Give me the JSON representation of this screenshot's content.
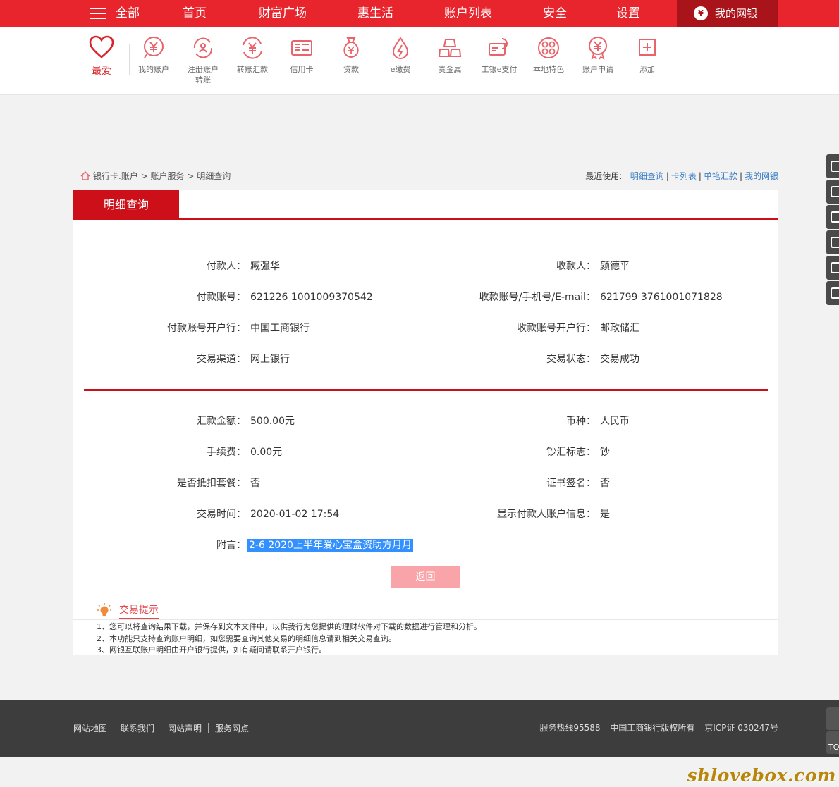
{
  "topnav": {
    "all": "全部",
    "items": [
      "首页",
      "财富广场",
      "惠生活",
      "账户列表",
      "安全",
      "设置"
    ],
    "mybank": "我的网银",
    "mybank_icon": "¥"
  },
  "shortcuts": {
    "fav": "最爱",
    "items": [
      {
        "label": "我的账户",
        "icon": "yen-circle-icon"
      },
      {
        "label": "注册账户转账",
        "icon": "person-transfer-icon"
      },
      {
        "label": "转账汇款",
        "icon": "yen-arrows-icon"
      },
      {
        "label": "信用卡",
        "icon": "card-icon"
      },
      {
        "label": "贷款",
        "icon": "money-bag-icon"
      },
      {
        "label": "e缴费",
        "icon": "drop-bolt-icon"
      },
      {
        "label": "贵金属",
        "icon": "gold-bars-icon"
      },
      {
        "label": "工银e支付",
        "icon": "epay-icon"
      },
      {
        "label": "本地特色",
        "icon": "dots-circle-icon"
      },
      {
        "label": "账户申请",
        "icon": "yen-ribbon-icon"
      },
      {
        "label": "添加",
        "icon": "plus-square-icon"
      }
    ]
  },
  "breadcrumb": {
    "items": [
      "银行卡.账户",
      "账户服务",
      "明细查询"
    ],
    "sep": ">"
  },
  "recent": {
    "label": "最近使用:",
    "links": [
      "明细查询",
      "卡列表",
      "单笔汇款",
      "我的网银"
    ]
  },
  "panel": {
    "tab": "明细查询",
    "fields_top_left": [
      {
        "k": "付款人：",
        "v": "臧强华"
      },
      {
        "k": "付款账号：",
        "v": "621226 1001009370542"
      },
      {
        "k": "付款账号开户行：",
        "v": "中国工商银行"
      },
      {
        "k": "交易渠道：",
        "v": "网上银行"
      }
    ],
    "fields_top_right": [
      {
        "k": "收款人：",
        "v": "颜德平"
      },
      {
        "k": "收款账号/手机号/E-mail：",
        "v": "621799 3761001071828"
      },
      {
        "k": "收款账号开户行：",
        "v": "邮政储汇"
      },
      {
        "k": "交易状态：",
        "v": "交易成功"
      }
    ],
    "fields_bottom_left": [
      {
        "k": "汇款金额：",
        "v": "500.00元"
      },
      {
        "k": "手续费：",
        "v": "0.00元"
      },
      {
        "k": "是否抵扣套餐：",
        "v": "否"
      },
      {
        "k": "交易时间：",
        "v": "2020-01-02 17:54"
      }
    ],
    "fields_bottom_right": [
      {
        "k": "币种：",
        "v": "人民币"
      },
      {
        "k": "钞汇标志：",
        "v": "钞"
      },
      {
        "k": "证书签名：",
        "v": "否"
      },
      {
        "k": "显示付款人账户信息：",
        "v": "是"
      }
    ],
    "remark": {
      "k": "附言：",
      "v": "2-6 2020上半年爱心宝盒资助方月月"
    },
    "back": "返回"
  },
  "tips": {
    "title": "交易提示",
    "lines": [
      "1、您可以将查询结果下载，并保存到文本文件中，以供我行为您提供的理财软件对下载的数据进行管理和分析。",
      "2、本功能只支持查询账户明细，如您需要查询其他交易的明细信息请到相关交易查询。",
      "3、网银互联账户明细由开户银行提供，如有疑问请联系开户银行。"
    ]
  },
  "footer": {
    "links": [
      "网站地图",
      "联系我们",
      "网站声明",
      "服务网点"
    ],
    "hotline": "服务热线95588",
    "copyright": "中国工商银行版权所有",
    "icp": "京ICP证 030247号",
    "totop": "TO"
  },
  "watermark": "shlovebox.com",
  "colors": {
    "brand_red": "#e8242c",
    "dark_red": "#cc0f18",
    "link_blue": "#3b7dc4"
  }
}
